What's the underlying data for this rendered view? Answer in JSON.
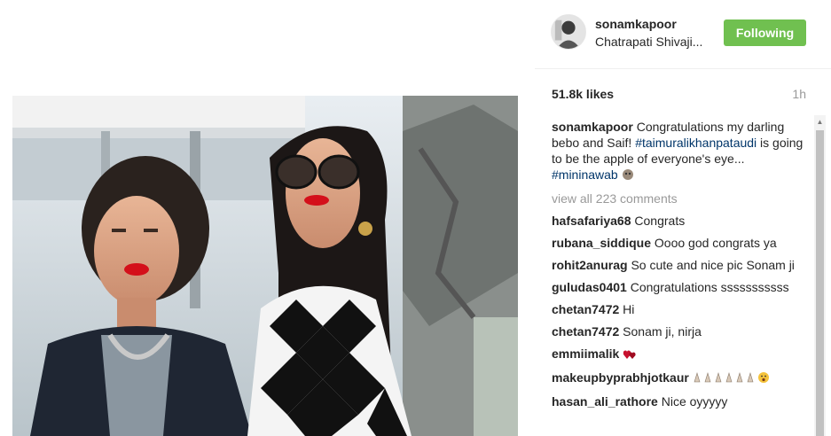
{
  "post": {
    "owner": {
      "username": "sonamkapoor",
      "location": "Chatrapati Shivaji..."
    },
    "follow_button_label": "Following",
    "likes": "51.8k likes",
    "time_ago": "1h",
    "caption": {
      "username": "sonamkapoor",
      "text_part1": "Congratulations my darling bebo and Saif!",
      "hashtag1": "#taimuralikhanpataudi",
      "text_part2": " is going to be the apple of everyone's eye... ",
      "hashtag2": "#mininawab"
    },
    "view_all_comments": "view all 223 comments",
    "comments": [
      {
        "username": "hafsafariya68",
        "text": "Congrats"
      },
      {
        "username": "rubana_siddique",
        "text": "Oooo god congrats ya"
      },
      {
        "username": "rohit2anurag",
        "text": "So cute and nice pic Sonam ji"
      },
      {
        "username": "guludas0401",
        "text": "Congratulations sssssssssss"
      },
      {
        "username": "chetan7472",
        "text": "Hi"
      },
      {
        "username": "chetan7472",
        "text": "Sonam ji, nirja"
      },
      {
        "username": "emmiimalik",
        "text": "",
        "emoji": "hearts-icon"
      },
      {
        "username": "makeupbyprabhjotkaur",
        "text": "",
        "emoji": "clapping-hands-icon"
      },
      {
        "username": "hasan_ali_rathore",
        "text": "Nice oyyyyy"
      }
    ]
  },
  "colors": {
    "follow_button": "#70c050",
    "hashtag": "#003569",
    "muted": "#999999"
  }
}
